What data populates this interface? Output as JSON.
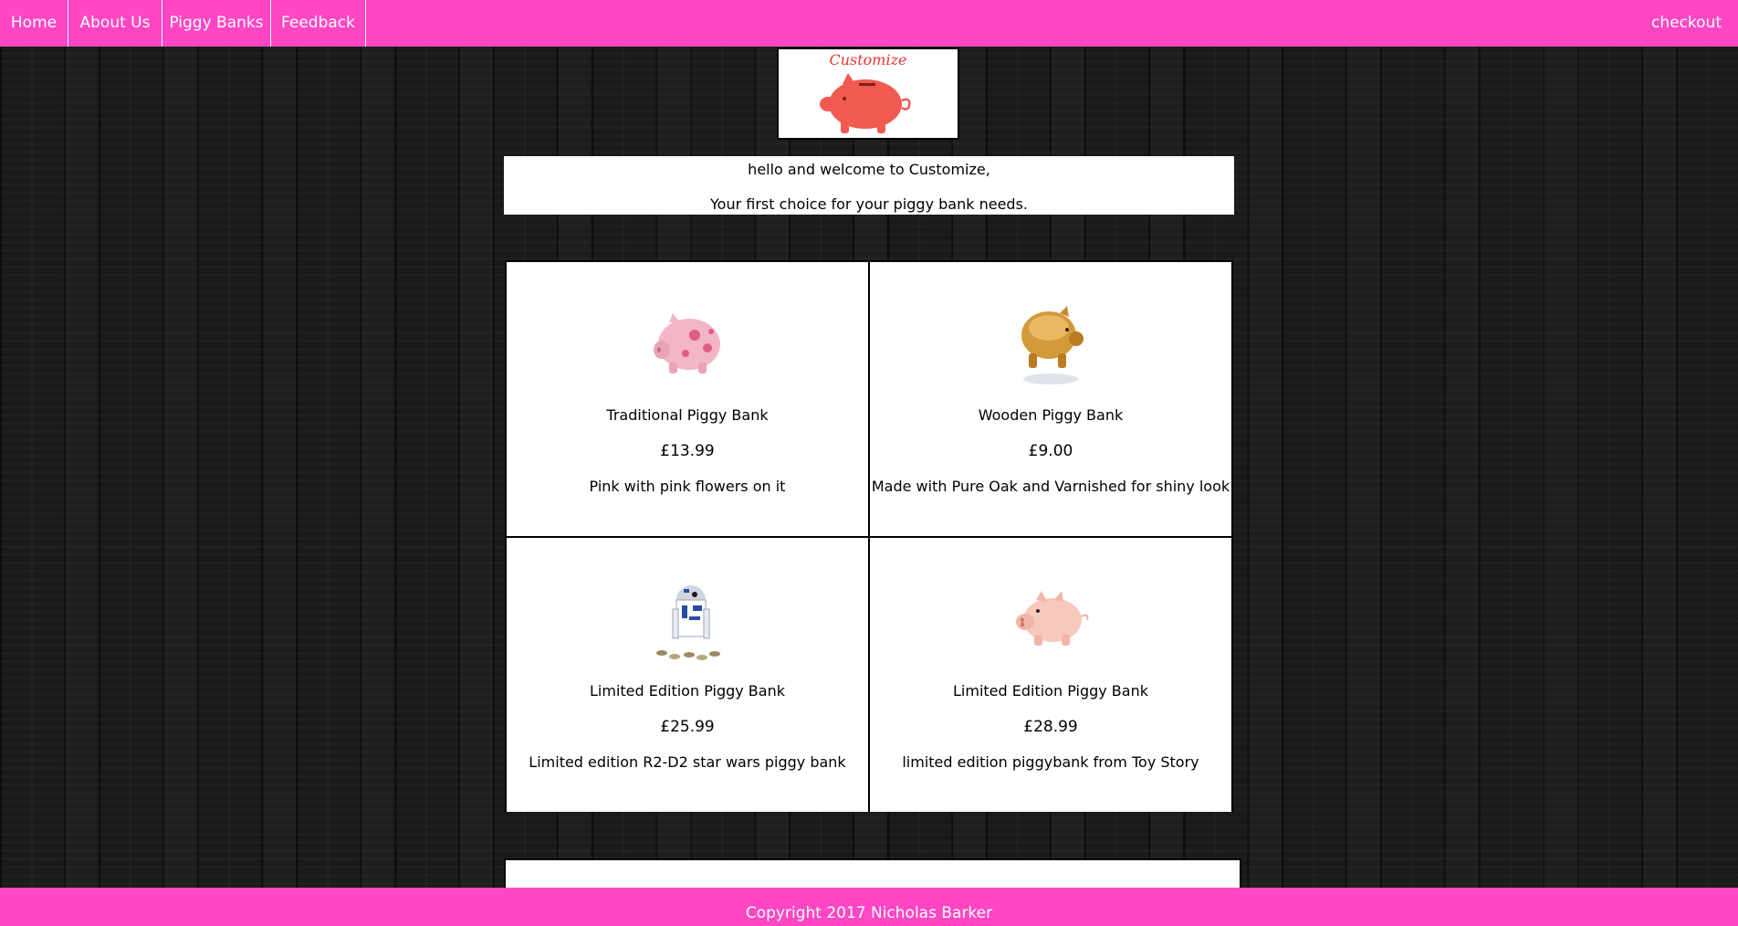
{
  "nav": {
    "home": "Home",
    "about": "About Us",
    "piggy_banks": "Piggy Banks",
    "feedback": "Feedback",
    "checkout": "checkout"
  },
  "logo": {
    "text": "Customize"
  },
  "welcome": {
    "line1": "hello and welcome to Customize,",
    "line2": "Your first choice for your piggy bank needs."
  },
  "products": [
    {
      "name": "Traditional Piggy Bank",
      "price": "£13.99",
      "description": "Pink with pink flowers on it",
      "image": "pink-flower-piggy-bank"
    },
    {
      "name": "Wooden Piggy Bank",
      "price": "£9.00",
      "description": "Made with Pure Oak and Varnished for shiny look",
      "image": "wooden-piggy-bank"
    },
    {
      "name": "Limited Edition Piggy Bank",
      "price": "£25.99",
      "description": "Limited edition R2-D2 star wars piggy bank",
      "image": "r2d2-piggy-bank"
    },
    {
      "name": "Limited Edition Piggy Bank",
      "price": "£28.99",
      "description": "limited edition piggybank from Toy Story",
      "image": "toy-story-hamm-piggy-bank"
    }
  ],
  "footer": {
    "copyright": "Copyright 2017 Nicholas Barker"
  },
  "colors": {
    "nav_bg": "#ff47c3",
    "page_bg": "#1b1b1b",
    "card_bg": "#ffffff"
  }
}
